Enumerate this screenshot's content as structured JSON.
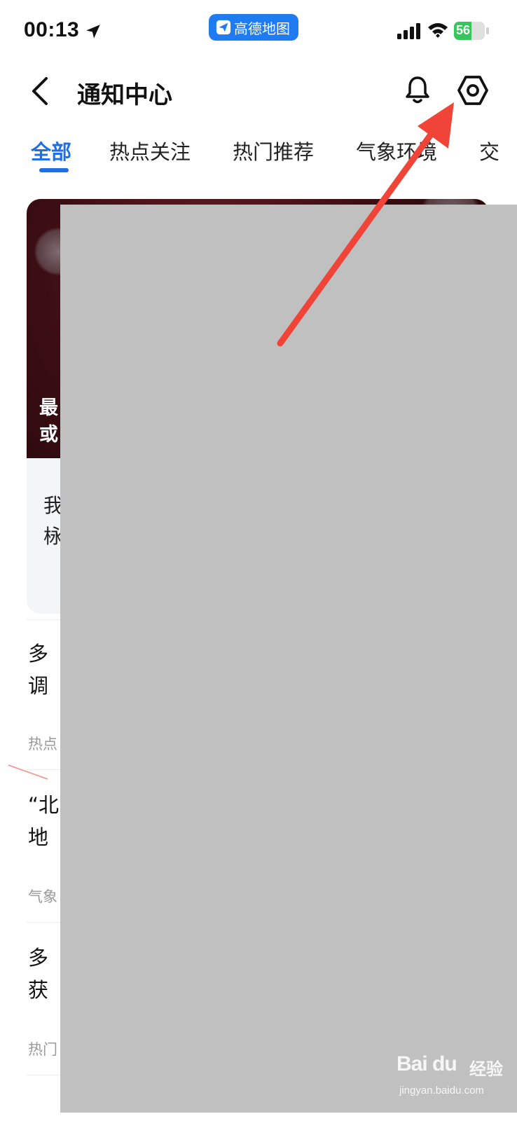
{
  "status_bar": {
    "time": "00:13",
    "app_badge": "高德地图",
    "battery_percent": 56,
    "battery_label": "56",
    "icons": [
      "location-arrow-icon",
      "signal-icon",
      "wifi-icon",
      "battery-charging-icon"
    ]
  },
  "header": {
    "title": "通知中心",
    "icons": [
      "back-icon",
      "bell-icon",
      "settings-icon"
    ]
  },
  "tabs": [
    {
      "label": "全部",
      "active": true
    },
    {
      "label": "热点关注",
      "active": false
    },
    {
      "label": "热门推荐",
      "active": false
    },
    {
      "label": "气象环境",
      "active": false
    },
    {
      "label": "交",
      "active": false
    }
  ],
  "feed": {
    "feature": {
      "title_fragment": "最\n或",
      "desc_fragment": "我\n栐"
    },
    "items": [
      {
        "title_fragment": "多\n调",
        "meta_fragment": "热点"
      },
      {
        "title_fragment": "“北\n地",
        "meta_fragment": "气象"
      },
      {
        "title_fragment": "多\n获",
        "meta_fragment": "热门"
      }
    ]
  },
  "watermark": {
    "brand": "Bai du",
    "brand_cn": "经验",
    "url": "jingyan.baidu.com"
  },
  "colors": {
    "accent": "#1f6fe5",
    "annotation_arrow": "#f04438",
    "redaction": "#c0c0c0",
    "battery_green": "#34c759"
  }
}
